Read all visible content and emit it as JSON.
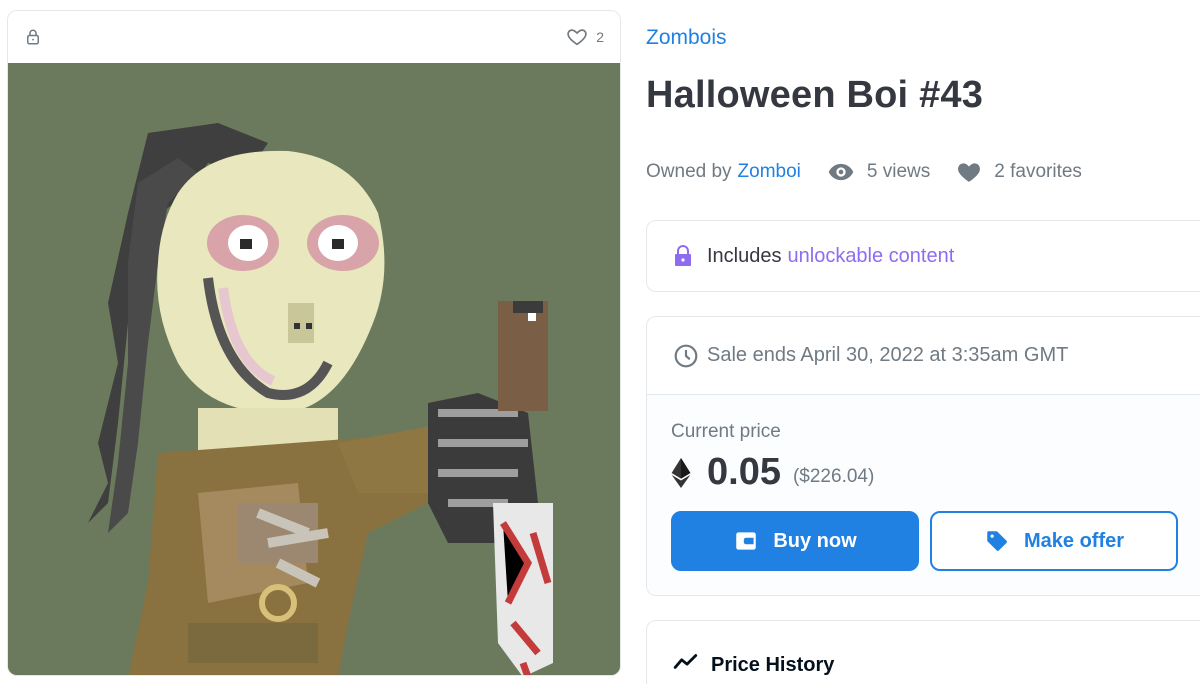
{
  "media": {
    "favorite_count": "2"
  },
  "asset": {
    "collection_name": "Zombois",
    "title": "Halloween Boi #43",
    "owned_by_label": "Owned by",
    "owner_name": "Zomboi",
    "views": "5 views",
    "favorites": "2 favorites"
  },
  "unlockable": {
    "prefix": "Includes",
    "link_text": "unlockable content"
  },
  "sale": {
    "ends_text": "Sale ends April 30, 2022 at 3:35am GMT",
    "current_price_label": "Current price",
    "price_eth": "0.05",
    "price_usd": "($226.04)",
    "buy_label": "Buy now",
    "offer_label": "Make offer"
  },
  "price_history": {
    "label": "Price History"
  },
  "colors": {
    "accent": "#2081e2",
    "unlockable_purple": "#8e6cf2",
    "text_primary": "#353840",
    "text_secondary": "#707a83",
    "image_background": "#6b7a5c"
  },
  "icons": {
    "lock": "lock-icon",
    "heart_outline": "heart-outline-icon",
    "eye": "eye-icon",
    "heart_filled": "heart-icon",
    "unlock_lock": "purple-lock-icon",
    "clock": "clock-icon",
    "eth": "ethereum-icon",
    "wallet": "wallet-icon",
    "tag": "tag-icon",
    "trend": "trending-icon"
  }
}
